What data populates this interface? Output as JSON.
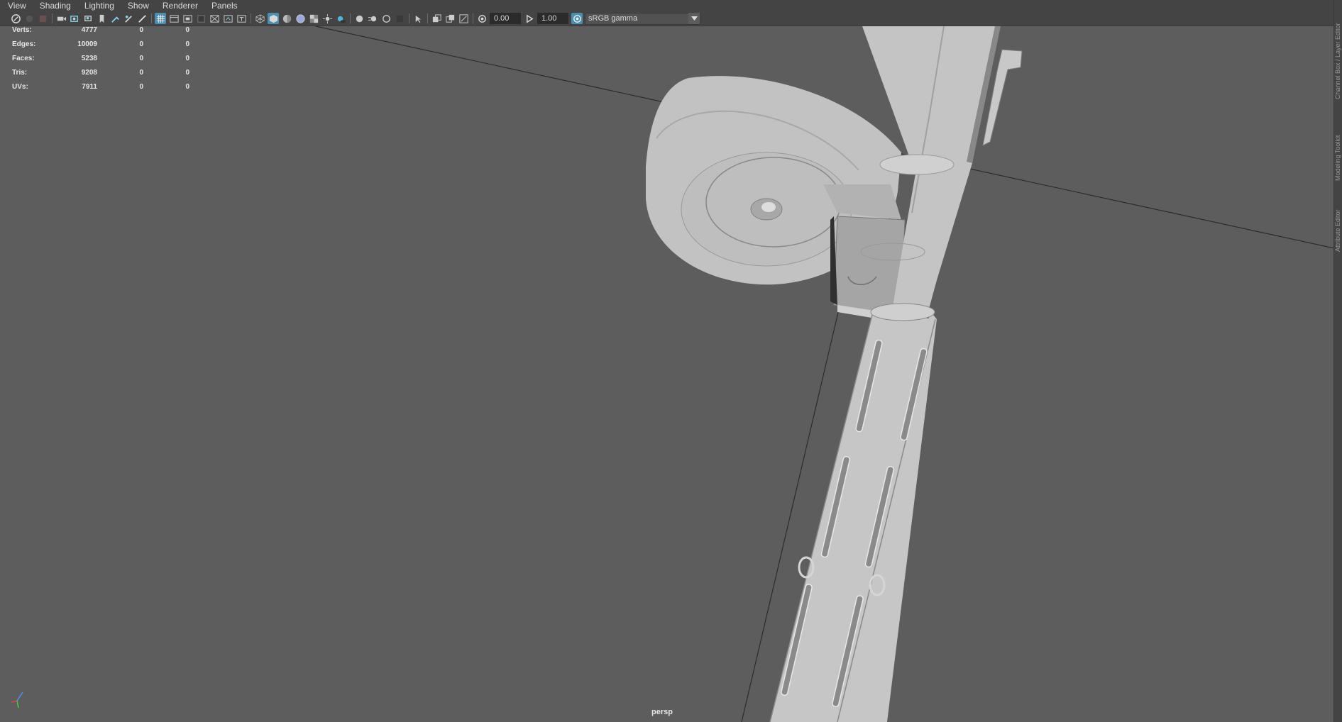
{
  "menu": {
    "items": [
      "View",
      "Shading",
      "Lighting",
      "Show",
      "Renderer",
      "Panels"
    ]
  },
  "toolbar": {
    "exposure": "0.00",
    "gamma": "1.00",
    "color_management": "sRGB gamma",
    "icons": [
      "select-camera-icon",
      "lock-camera-icon",
      "camera-attributes-icon",
      "image-plane-icon",
      "bookmark-icon",
      "2d-pan-zoom-icon",
      "grease-pencil-icon",
      "grid-icon",
      "film-gate-icon",
      "resolution-gate-icon",
      "gate-mask-icon",
      "field-chart-icon",
      "safe-action-icon",
      "safe-title-icon",
      "wireframe-icon",
      "smooth-shade-icon",
      "use-default-material-icon",
      "wireframe-on-shaded-icon",
      "textured-icon",
      "use-all-lights-icon",
      "shadows-icon",
      "screen-space-ao-icon",
      "motion-blur-icon",
      "multisample-aa-icon",
      "depth-of-field-icon",
      "isolate-select-icon",
      "xray-icon",
      "xray-active-icon",
      "xray-joints-icon",
      "exposure-icon",
      "gamma-icon",
      "view-transform-icon"
    ],
    "active_color": "#4a8fb0"
  },
  "hud": {
    "rows": [
      {
        "label": "Verts:",
        "v1": "4777",
        "v2": "0",
        "v3": "0"
      },
      {
        "label": "Edges:",
        "v1": "10009",
        "v2": "0",
        "v3": "0"
      },
      {
        "label": "Faces:",
        "v1": "5238",
        "v2": "0",
        "v3": "0"
      },
      {
        "label": "Tris:",
        "v1": "9208",
        "v2": "0",
        "v3": "0"
      },
      {
        "label": "UVs:",
        "v1": "7911",
        "v2": "0",
        "v3": "0"
      }
    ]
  },
  "viewport": {
    "camera": "persp",
    "background": "#5d5d5d"
  },
  "side_tabs": [
    "Channel Box / Layer Editor",
    "Modeling Toolkit",
    "Attribute Editor"
  ]
}
